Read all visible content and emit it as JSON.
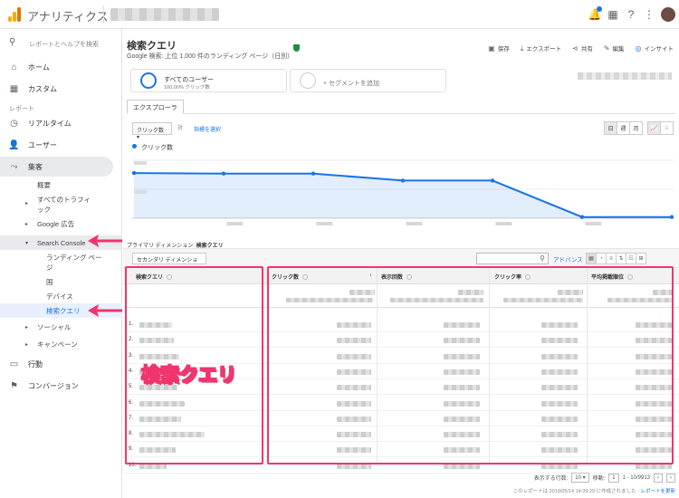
{
  "app": {
    "title": "アナリティクス"
  },
  "sidebar": {
    "search_label": "レポートとヘルプを検索",
    "home": "ホーム",
    "custom": "カスタム",
    "section_reports": "レポート",
    "realtime": "リアルタイム",
    "users": "ユーザー",
    "acquisition": "集客",
    "acq_sub": {
      "overview": "概要",
      "all_traffic_line1": "すべてのトラフィ",
      "all_traffic_line2": "ック",
      "google_ads": "Google 広告",
      "search_console": "Search Console",
      "landing_page_line1": "ランディング ペー",
      "landing_page_line2": "ジ",
      "country": "国",
      "device": "デバイス",
      "search_query": "検索クエリ",
      "social": "ソーシャル",
      "campaign": "キャンペーン"
    },
    "behavior": "行動",
    "conversion": "コンバージョン"
  },
  "report": {
    "title": "検索クエリ",
    "subtitle": "Google 検索: 上位 1,000 件のランディング ページ（日別）",
    "actions": {
      "save": "保存",
      "export": "エクスポート",
      "share": "共有",
      "edit": "編集",
      "insight": "インサイト"
    }
  },
  "segments": {
    "all_users": "すべてのユーザー",
    "all_users_sub": "100.00% クリック数",
    "add_segment": "+ セグメントを追加"
  },
  "explorer_tab": "エクスプローラ",
  "chart_controls": {
    "metric_dropdown": "クリック数",
    "vs": "対",
    "select_metric": "指標を選択",
    "day": "日",
    "week": "週",
    "month": "月"
  },
  "chart_data": {
    "type": "line",
    "series": [
      {
        "name": "クリック数",
        "values": [
          0.78,
          0.77,
          0.77,
          0.65,
          0.65,
          0.02,
          0.02
        ]
      }
    ],
    "ylim": [
      0,
      1
    ],
    "grid": true,
    "color": "#1a73e8"
  },
  "table": {
    "primary_dimension_label": "プライマリ ディメンション:",
    "primary_dimension_value": "検索クエリ",
    "secondary_dimension": "セカンダリ ディメンション",
    "advanced": "アドバンス",
    "headers": {
      "query": "検索クエリ",
      "clicks": "クリック数",
      "impressions": "表示回数",
      "ctr": "クリック率",
      "position": "平均掲載順位"
    },
    "row_numbers": [
      "1.",
      "2.",
      "3.",
      "4.",
      "5.",
      "6.",
      "7.",
      "8.",
      "9.",
      "10."
    ]
  },
  "annotation_label": "検索クエリ",
  "footer": {
    "rows_label": "表示する行数:",
    "rows_value": "10",
    "goto_label": "移動:",
    "goto_value": "1",
    "range": "1 - 10/9913",
    "created": "このレポートは 2019/05/14 14:39:29 に作成されました -",
    "refresh": "レポートを更新"
  },
  "colors": {
    "accent": "#1a73e8",
    "highlight": "#f0356d",
    "line": "#1a73e8"
  }
}
